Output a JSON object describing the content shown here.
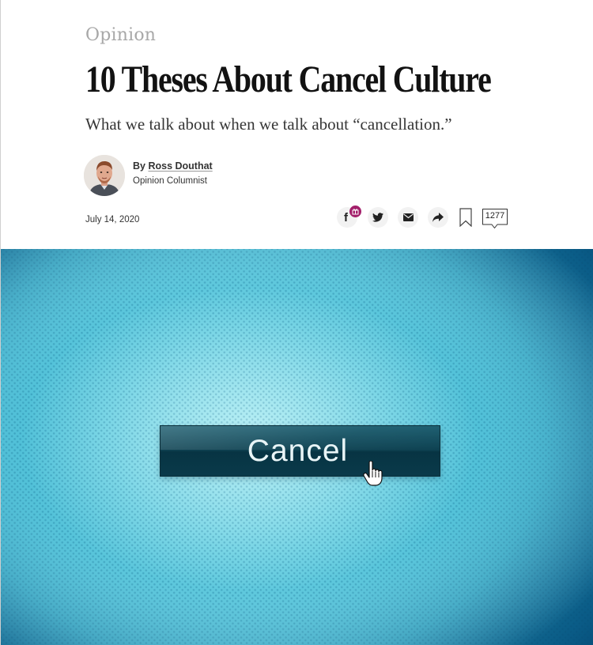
{
  "article": {
    "section": "Opinion",
    "headline": "10 Theses About Cancel Culture",
    "summary": "What we talk about when we talk about “cancellation.”",
    "byline_prefix": "By ",
    "author": "Ross Douthat",
    "author_role": "Opinion Columnist",
    "date": "July 14, 2020"
  },
  "share_tools": {
    "facebook_label": "f",
    "icons": [
      "facebook-icon",
      "twitter-icon",
      "email-icon",
      "share-icon",
      "bookmark-icon",
      "comment-icon"
    ],
    "comments_count": "1277",
    "badge_color": "#a3206b"
  },
  "hero": {
    "button_label": "Cancel",
    "icons": [
      "hand-cursor-icon"
    ],
    "colors": {
      "background_light": "#aeeef4",
      "background_dark": "#064b7a",
      "button": "#0e4252"
    }
  },
  "colors": {
    "section_label": "#a8a8a8",
    "headline": "#121212",
    "summary": "#363636",
    "meta_text": "#333333"
  }
}
